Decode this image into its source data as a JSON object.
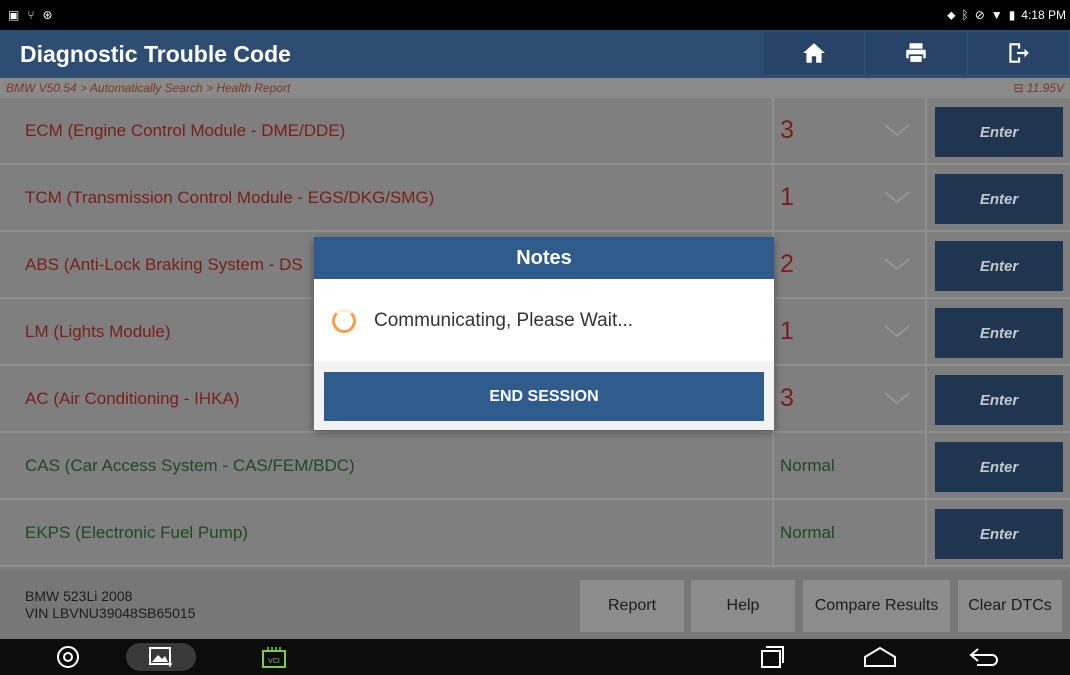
{
  "status_bar": {
    "left_icons": [
      "photo-icon",
      "usb-icon",
      "sync-icon"
    ],
    "right_icons": [
      "location-icon",
      "bluetooth-icon",
      "block-icon",
      "wifi-icon",
      "battery-icon"
    ],
    "time": "4:18 PM"
  },
  "header": {
    "title": "Diagnostic Trouble Code",
    "buttons": [
      "home-icon",
      "print-icon",
      "exit-icon"
    ]
  },
  "breadcrumb": {
    "path": "BMW V50.54 > Automatically Search > Health Report",
    "voltage": "11.95V"
  },
  "modules": [
    {
      "name": "ECM (Engine Control Module - DME/DDE)",
      "count": "3",
      "state": "fault",
      "enter": "Enter"
    },
    {
      "name": "TCM (Transmission Control Module - EGS/DKG/SMG)",
      "count": "1",
      "state": "fault",
      "enter": "Enter"
    },
    {
      "name": "ABS (Anti-Lock Braking System - DS",
      "count": "2",
      "state": "fault",
      "enter": "Enter"
    },
    {
      "name": "LM (Lights Module)",
      "count": "1",
      "state": "fault",
      "enter": "Enter"
    },
    {
      "name": "AC (Air Conditioning - IHKA)",
      "count": "3",
      "state": "fault",
      "enter": "Enter"
    },
    {
      "name": "CAS (Car Access System - CAS/FEM/BDC)",
      "status": "Normal",
      "state": "ok",
      "enter": "Enter"
    },
    {
      "name": "EKPS (Electronic Fuel Pump)",
      "status": "Normal",
      "state": "ok",
      "enter": "Enter"
    }
  ],
  "vehicle": {
    "model": "BMW 523Li 2008",
    "vin": "VIN LBVNU39048SB65015"
  },
  "bottom_buttons": {
    "report": "Report",
    "help": "Help",
    "compare": "Compare Results",
    "clear": "Clear DTCs"
  },
  "dialog": {
    "title": "Notes",
    "message": "Communicating, Please Wait...",
    "button": "END SESSION"
  },
  "nav_bar": {
    "vci_label": "VCI"
  },
  "colors": {
    "header": "#2e4d72",
    "dialog_accent": "#2f5b8d",
    "fault_text": "#7a1f1a",
    "ok_text": "#1f4a22"
  }
}
